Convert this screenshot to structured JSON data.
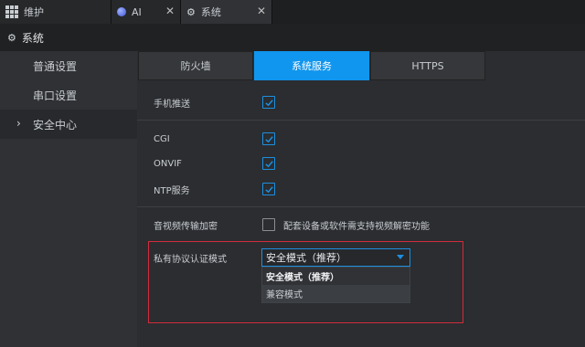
{
  "top_tabs": [
    {
      "label": "维护",
      "icon": "grid-icon"
    },
    {
      "label": "AI",
      "icon": "ai-icon",
      "close": "✕"
    },
    {
      "label": "系统",
      "icon": "gear-icon",
      "close": "✕"
    }
  ],
  "header": {
    "title": "系统",
    "icon": "gear-icon"
  },
  "sidebar": {
    "items": [
      {
        "label": "普通设置"
      },
      {
        "label": "串口设置"
      },
      {
        "label": "安全中心",
        "chevron": "›"
      }
    ]
  },
  "content_tabs": [
    "防火墙",
    "系统服务",
    "HTTPS"
  ],
  "settings": {
    "mobile_push": {
      "label": "手机推送",
      "checked": true
    },
    "cgi": {
      "label": "CGI",
      "checked": true
    },
    "onvif": {
      "label": "ONVIF",
      "checked": true
    },
    "ntp": {
      "label": "NTP服务",
      "checked": true
    },
    "av_encrypt": {
      "label": "音视频传输加密",
      "checked": false,
      "note": "配套设备或软件需支持视频解密功能"
    },
    "private_auth": {
      "label": "私有协议认证模式",
      "selected": "安全模式（推荐）",
      "options": [
        "安全模式（推荐）",
        "兼容模式"
      ]
    }
  },
  "colors": {
    "accent": "#1096ee",
    "highlight_border": "#d02c3d"
  }
}
